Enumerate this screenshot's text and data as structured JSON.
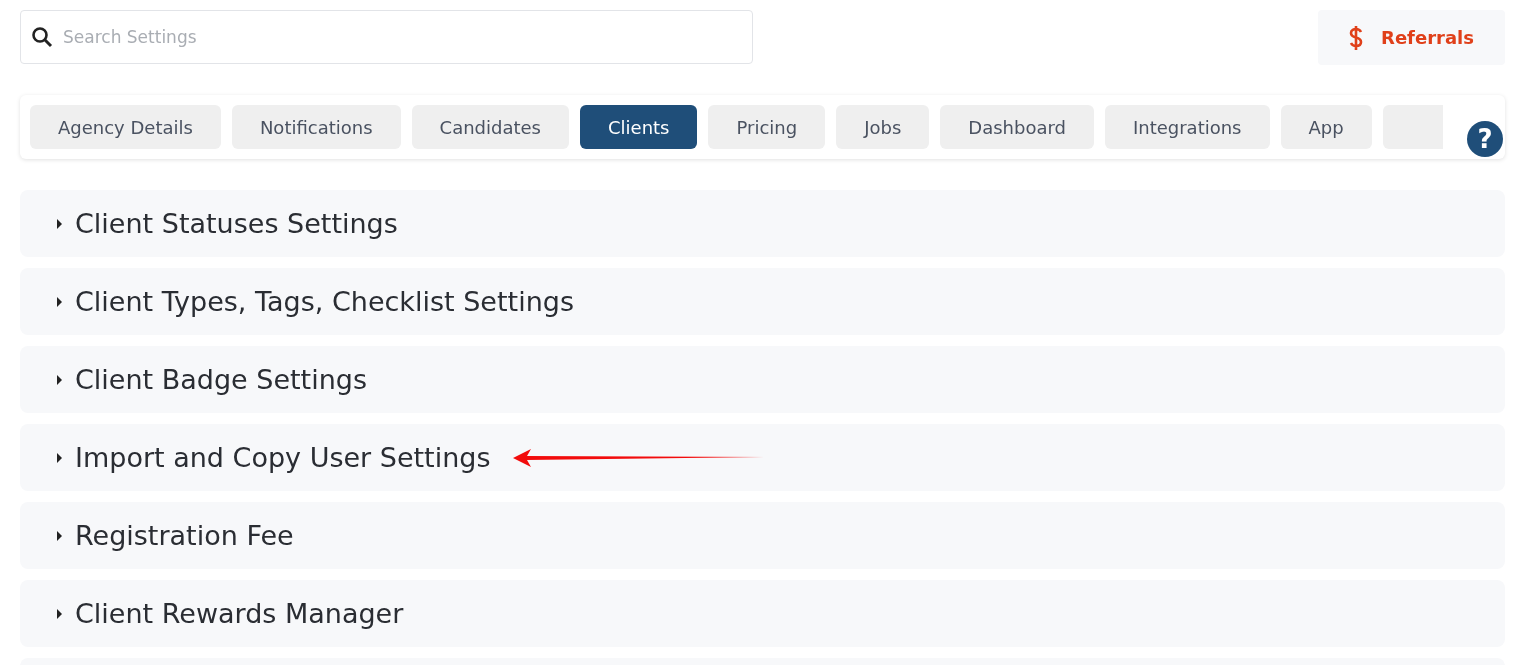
{
  "search": {
    "placeholder": "Search Settings"
  },
  "referrals_button": {
    "label": "Referrals"
  },
  "tabs": [
    {
      "label": "Agency Details",
      "selected": false
    },
    {
      "label": "Notifications",
      "selected": false
    },
    {
      "label": "Candidates",
      "selected": false
    },
    {
      "label": "Clients",
      "selected": true
    },
    {
      "label": "Pricing",
      "selected": false
    },
    {
      "label": "Jobs",
      "selected": false
    },
    {
      "label": "Dashboard",
      "selected": false
    },
    {
      "label": "Integrations",
      "selected": false
    },
    {
      "label": "App",
      "selected": false
    }
  ],
  "help_button": {
    "label": "?"
  },
  "sections": [
    {
      "title": "Client Statuses Settings",
      "expanded": false,
      "annotated": false
    },
    {
      "title": "Client Types, Tags, Checklist Settings",
      "expanded": false,
      "annotated": false
    },
    {
      "title": "Client Badge Settings",
      "expanded": false,
      "annotated": false
    },
    {
      "title": "Import and Copy User Settings",
      "expanded": false,
      "annotated": true
    },
    {
      "title": "Registration Fee",
      "expanded": false,
      "annotated": false
    },
    {
      "title": "Client Rewards Manager",
      "expanded": false,
      "annotated": false
    }
  ]
}
